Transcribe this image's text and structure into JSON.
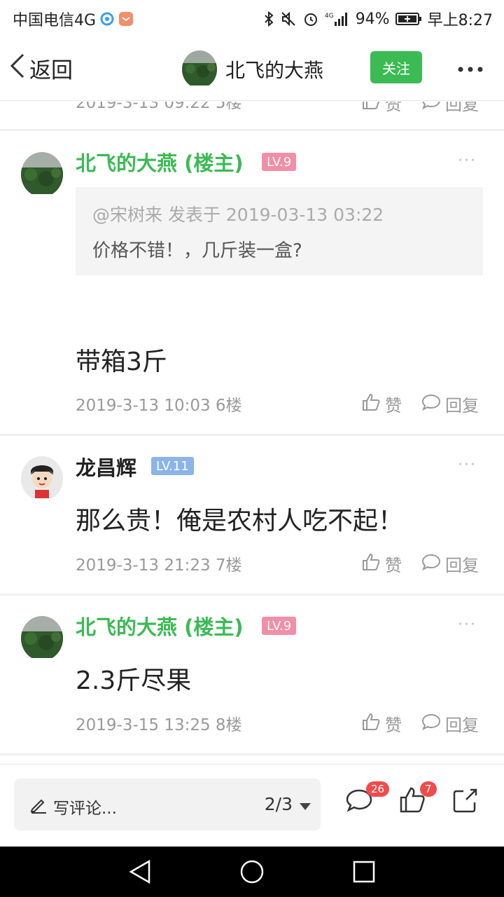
{
  "status_bar": {
    "carrier": "中国电信4G",
    "battery": "94%",
    "time": "早上8:27",
    "network_small": "4G"
  },
  "header": {
    "back_label": "返回",
    "user_name": "北飞的大燕",
    "follow_label": "关注"
  },
  "feed": {
    "partial_meta": "2019-3-13 09:22 5楼",
    "partial_like": "赞",
    "partial_reply": "回复",
    "posts": [
      {
        "username": "北飞的大燕 (楼主)",
        "level": "LV.9",
        "quote_header": "@宋树来 发表于 2019-03-13 03:22",
        "quote_text": "价格不错！，几斤装一盒?",
        "text": "带箱3斤",
        "meta": "2019-3-13 10:03  6楼",
        "like_label": "赞",
        "reply_label": "回复"
      },
      {
        "username": "龙昌辉",
        "level": "LV.11",
        "text": "那么贵！俺是农村人吃不起！",
        "meta": "2019-3-13 21:23  7楼",
        "like_label": "赞",
        "reply_label": "回复"
      },
      {
        "username": "北飞的大燕 (楼主)",
        "level": "LV.9",
        "text": "2.3斤尽果",
        "meta": "2019-3-15 13:25  8楼",
        "like_label": "赞",
        "reply_label": "回复"
      }
    ]
  },
  "bottom_bar": {
    "comment_placeholder": "写评论...",
    "page_indicator": "2/3",
    "comment_count": "26",
    "like_count": "7"
  },
  "colors": {
    "accent_green": "#3cba54",
    "level_pink": "#f28ea6",
    "level_blue": "#8ab4ea",
    "badge_red": "#f04b4b"
  }
}
